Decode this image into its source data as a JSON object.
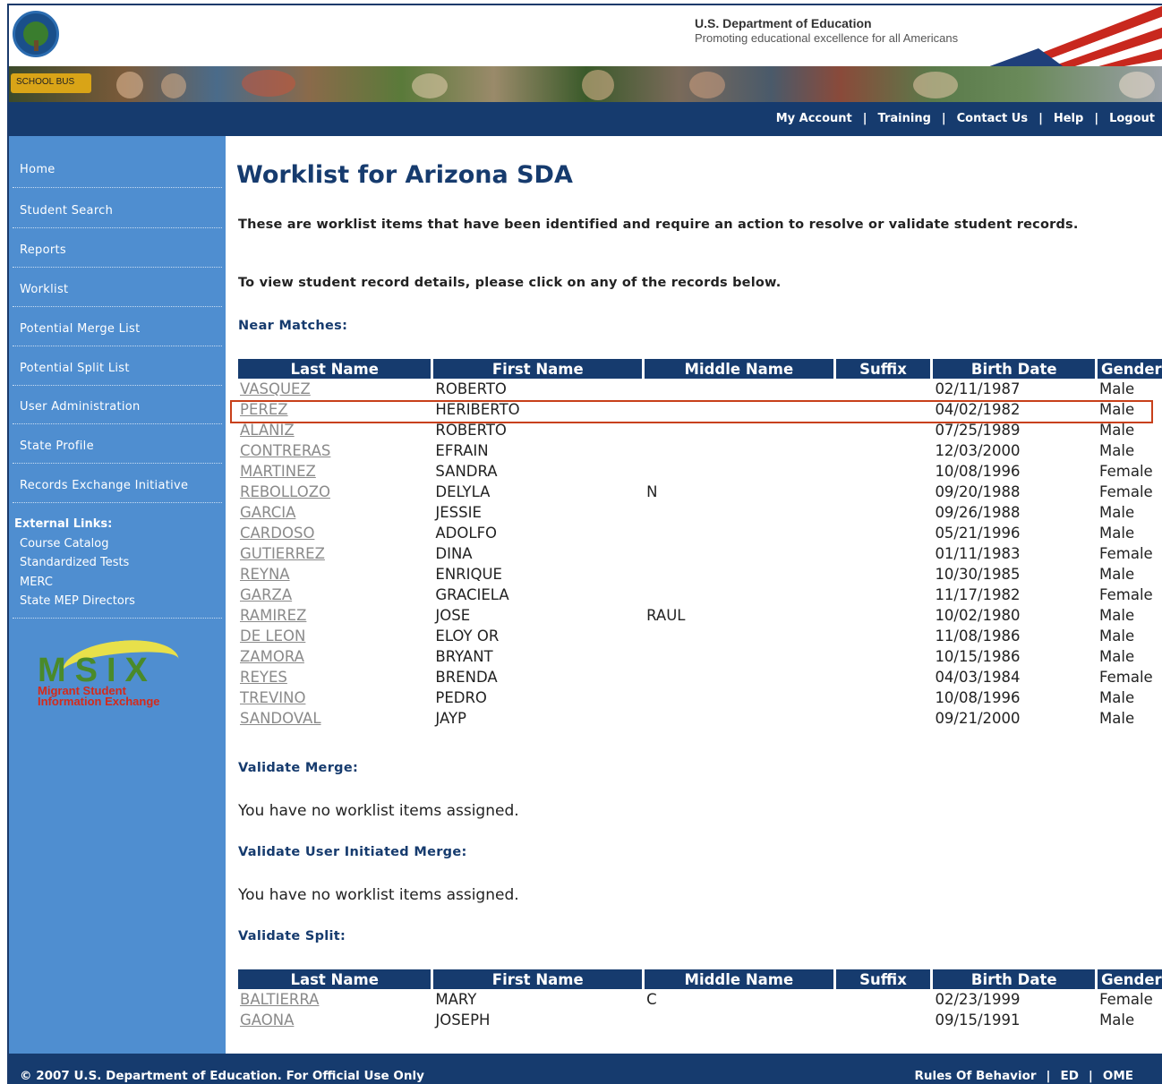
{
  "header": {
    "dept_title": "U.S. Department of Education",
    "dept_subtitle": "Promoting educational excellence for all Americans",
    "bus_label": "SCHOOL BUS"
  },
  "topnav": [
    "My Account",
    "Training",
    "Contact Us",
    "Help",
    "Logout"
  ],
  "sidebar": {
    "items": [
      "Home",
      "Student Search",
      "Reports",
      "Worklist",
      "Potential Merge List",
      "Potential Split List",
      "User Administration",
      "State Profile",
      "Records Exchange Initiative"
    ],
    "external_title": "External Links:",
    "external_links": [
      "Course Catalog",
      "Standardized Tests",
      "MERC",
      "State MEP Directors"
    ],
    "logo_text": "MSIX",
    "logo_sub1": "Migrant Student",
    "logo_sub2": "Information Exchange"
  },
  "main": {
    "title": "Worklist for Arizona SDA",
    "intro": "These are worklist items that have been identified and require an action to resolve or validate student records.",
    "intro2": "To view student record details, please click on any of the records below.",
    "near_matches_title": "Near Matches:",
    "columns": [
      "Last Name",
      "First Name",
      "Middle Name",
      "Suffix",
      "Birth Date",
      "Gender"
    ],
    "near_matches": [
      [
        "VASQUEZ",
        "ROBERTO",
        "",
        "",
        "02/11/1987",
        "Male"
      ],
      [
        "PEREZ",
        "HERIBERTO",
        "",
        "",
        "04/02/1982",
        "Male"
      ],
      [
        "ALANIZ",
        "ROBERTO",
        "",
        "",
        "07/25/1989",
        "Male"
      ],
      [
        "CONTRERAS",
        "EFRAIN",
        "",
        "",
        "12/03/2000",
        "Male"
      ],
      [
        "MARTINEZ",
        "SANDRA",
        "",
        "",
        "10/08/1996",
        "Female"
      ],
      [
        "REBOLLOZO",
        "DELYLA",
        "N",
        "",
        "09/20/1988",
        "Female"
      ],
      [
        "GARCIA",
        "JESSIE",
        "",
        "",
        "09/26/1988",
        "Male"
      ],
      [
        "CARDOSO",
        "ADOLFO",
        "",
        "",
        "05/21/1996",
        "Male"
      ],
      [
        "GUTIERREZ",
        "DINA",
        "",
        "",
        "01/11/1983",
        "Female"
      ],
      [
        "REYNA",
        "ENRIQUE",
        "",
        "",
        "10/30/1985",
        "Male"
      ],
      [
        "GARZA",
        "GRACIELA",
        "",
        "",
        "11/17/1982",
        "Female"
      ],
      [
        "RAMIREZ",
        "JOSE",
        "RAUL",
        "",
        "10/02/1980",
        "Male"
      ],
      [
        "DE LEON",
        "ELOY OR",
        "",
        "",
        "11/08/1986",
        "Male"
      ],
      [
        "ZAMORA",
        "BRYANT",
        "",
        "",
        "10/15/1986",
        "Male"
      ],
      [
        "REYES",
        "BRENDA",
        "",
        "",
        "04/03/1984",
        "Female"
      ],
      [
        "TREVINO",
        "PEDRO",
        "",
        "",
        "10/08/1996",
        "Male"
      ],
      [
        "SANDOVAL",
        "JAYP",
        "",
        "",
        "09/21/2000",
        "Male"
      ]
    ],
    "validate_merge_title": "Validate Merge:",
    "validate_merge_msg": "You have no worklist items assigned.",
    "validate_user_merge_title": "Validate User Initiated Merge:",
    "validate_user_merge_msg": "You have no worklist items assigned.",
    "validate_split_title": "Validate Split:",
    "validate_split": [
      [
        "BALTIERRA",
        "MARY",
        "C",
        "",
        "02/23/1999",
        "Female"
      ],
      [
        "GAONA",
        "JOSEPH",
        "",
        "",
        "09/15/1991",
        "Male"
      ]
    ]
  },
  "footer": {
    "copyright": "© 2007 U.S. Department of Education. For Official Use Only",
    "links": [
      "Rules Of Behavior",
      "ED",
      "OME"
    ]
  },
  "colors": {
    "navy": "#163b6e",
    "sidebar": "#4f8ed0",
    "highlight": "#c8401a"
  }
}
